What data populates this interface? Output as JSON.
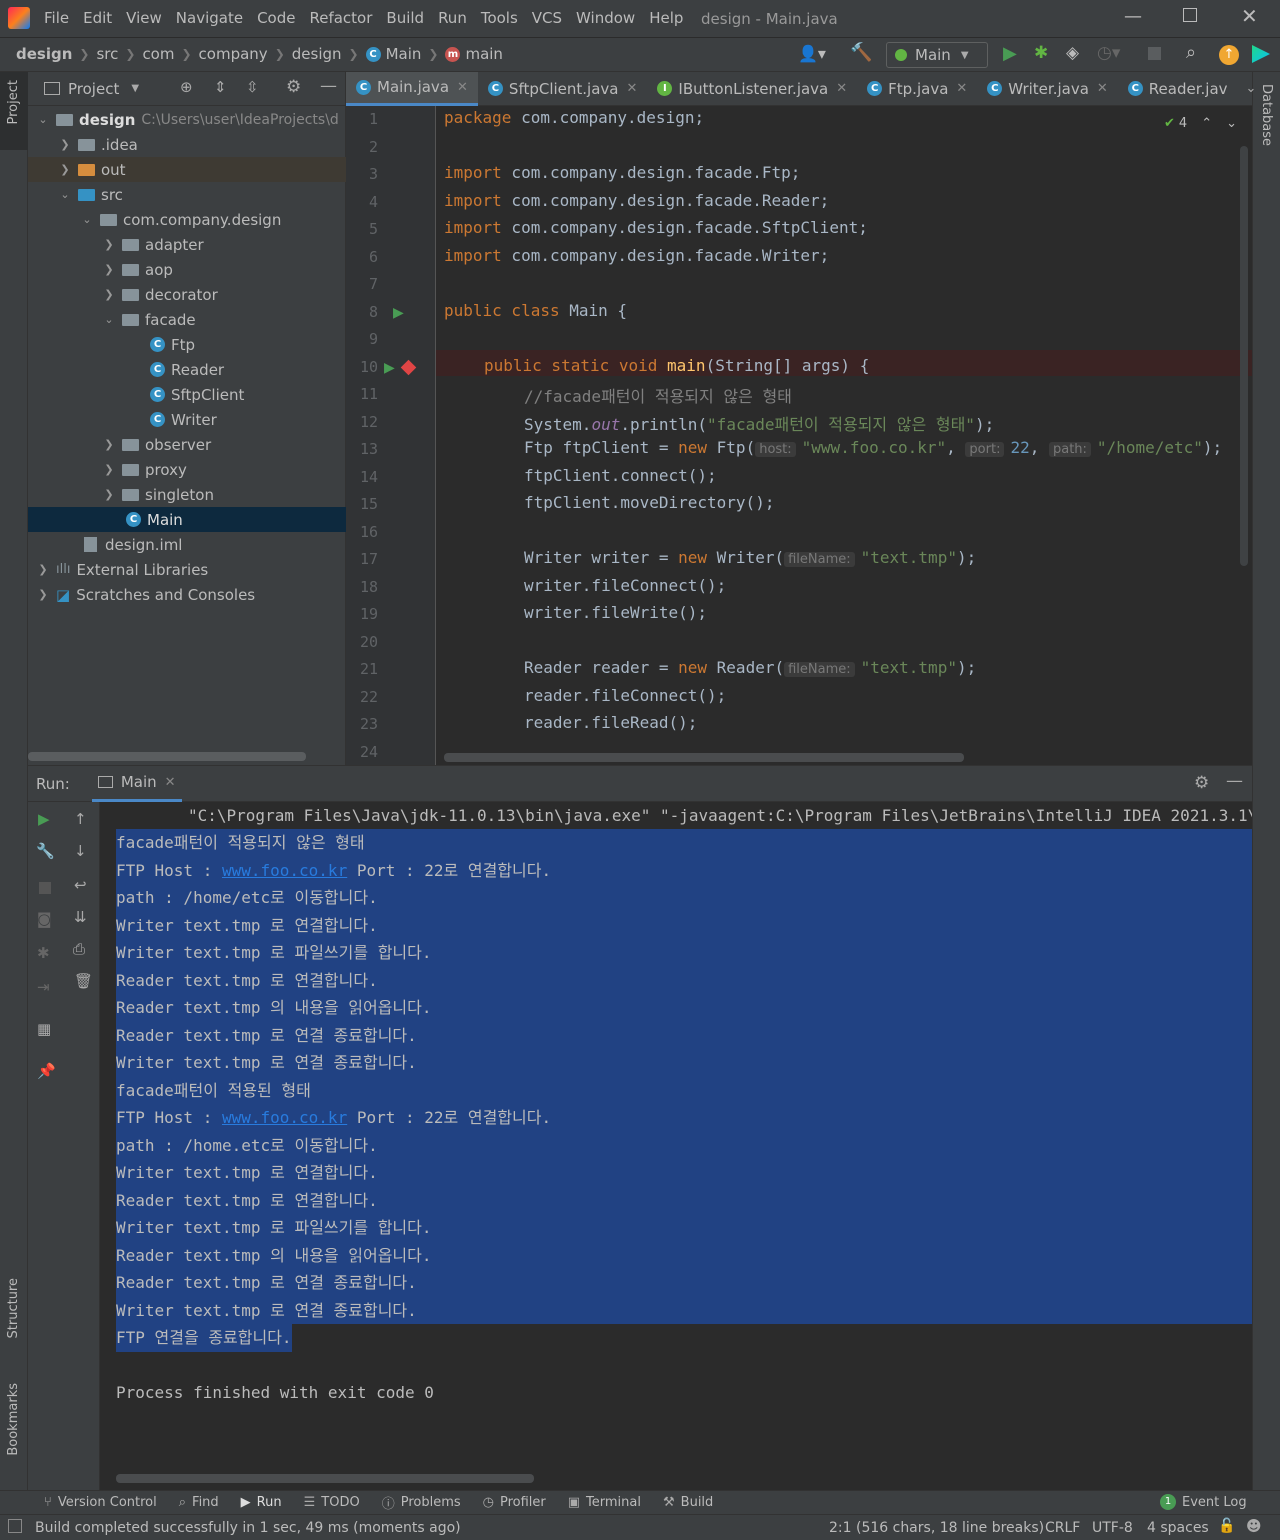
{
  "app": {
    "window_title": "design - Main.java",
    "menu": [
      "File",
      "Edit",
      "View",
      "Navigate",
      "Code",
      "Refactor",
      "Build",
      "Run",
      "Tools",
      "VCS",
      "Window",
      "Help"
    ]
  },
  "breadcrumb": [
    "design",
    "src",
    "com",
    "company",
    "design",
    "Main",
    "main"
  ],
  "toolbar": {
    "run_config": "Main"
  },
  "left_stripe": {
    "project": "Project",
    "structure": "Structure",
    "bookmarks": "Bookmarks"
  },
  "right_stripe": {
    "database": "Database"
  },
  "project": {
    "title": "Project",
    "root_name": "design",
    "root_path": "C:\\Users\\user\\IdeaProjects\\d",
    "items": [
      ".idea",
      "out",
      "src",
      "com.company.design",
      "adapter",
      "aop",
      "decorator",
      "facade",
      "Ftp",
      "Reader",
      "SftpClient",
      "Writer",
      "observer",
      "proxy",
      "singleton",
      "Main",
      "design.iml",
      "External Libraries",
      "Scratches and Consoles"
    ]
  },
  "tabs": [
    "Main.java",
    "SftpClient.java",
    "IButtonListener.java",
    "Ftp.java",
    "Writer.java",
    "Reader.jav"
  ],
  "editor": {
    "inspections": "4",
    "lines": [
      "1",
      "2",
      "3",
      "4",
      "5",
      "6",
      "7",
      "8",
      "9",
      "10",
      "11",
      "12",
      "13",
      "14",
      "15",
      "16",
      "17",
      "18",
      "19",
      "20",
      "21",
      "22",
      "23",
      "24"
    ],
    "package_kw": "package",
    "package_name": " com.company.design;",
    "import_kw": "import",
    "imports": [
      " com.company.design.facade.Ftp;",
      " com.company.design.facade.Reader;",
      " com.company.design.facade.SftpClient;",
      " com.company.design.facade.Writer;"
    ],
    "class_kw": "public class",
    "class_rest": " Main {",
    "main_kw": "public static void",
    "main_name": "main",
    "main_rest": "(String[] args) {",
    "comment": "//facade패턴이 적용되지 않은 형태",
    "println_a": "System.",
    "println_out": "out",
    "println_b": ".println(",
    "println_str": "\"facade패턴이 적용되지 않은 형태\"",
    "println_c": ");",
    "ftp_a": "Ftp ftpClient = ",
    "new": "new",
    "ftp_b": " Ftp(",
    "hint_host": "host:",
    "ftp_host": "\"www.foo.co.kr\"",
    "hint_port": "port:",
    "ftp_port": "22",
    "hint_path": "path:",
    "ftp_path": "\"/home/etc\"",
    "ftp_end": ");",
    "connect": "ftpClient.connect();",
    "move": "ftpClient.moveDirectory();",
    "writer_a": "Writer writer = ",
    "writer_b": " Writer(",
    "hint_file": "fileName:",
    "tmp": "\"text.tmp\"",
    "end": ");",
    "wconnect": "writer.fileConnect();",
    "wwrite": "writer.fileWrite();",
    "reader_a": "Reader reader = ",
    "reader_b": " Reader(",
    "rconnect": "reader.fileConnect();",
    "rread": "reader.fileRead();",
    "comma": ", "
  },
  "run": {
    "label": "Run:",
    "tab": "Main",
    "command": "\"C:\\Program Files\\Java\\jdk-11.0.13\\bin\\java.exe\" \"-javaagent:C:\\Program Files\\JetBrains\\IntelliJ IDEA 2021.3.1\\lib",
    "host_prefix": "FTP Host : ",
    "host_link": "www.foo.co.kr",
    "host_suffix": " Port : 22로 연결합니다.",
    "out": [
      "facade패턴이 적용되지 않은 형태",
      "path : /home/etc로 이동합니다.",
      "Writer text.tmp 로 연결합니다.",
      "Writer text.tmp 로 파일쓰기를 합니다.",
      "Reader text.tmp 로 연결합니다.",
      "Reader text.tmp 의 내용을 읽어옵니다.",
      "Reader text.tmp 로 연결 종료합니다.",
      "Writer text.tmp 로 연결 종료합니다.",
      "facade패턴이 적용된 형태",
      "path : /home.etc로 이동합니다.",
      "Writer text.tmp 로 연결합니다.",
      "Reader text.tmp 로 연결합니다.",
      "Writer text.tmp 로 파일쓰기를 합니다.",
      "Reader text.tmp 의 내용을 읽어옵니다.",
      "Reader text.tmp 로 연결 종료합니다.",
      "Writer text.tmp 로 연결 종료합니다.",
      "FTP 연결을 종료합니다.",
      "Process finished with exit code 0"
    ]
  },
  "bottom_tools": [
    "Version Control",
    "Find",
    "Run",
    "TODO",
    "Problems",
    "Profiler",
    "Terminal",
    "Build"
  ],
  "event_log": {
    "count": "1",
    "label": "Event Log"
  },
  "status": {
    "message": "Build completed successfully in 1 sec, 49 ms (moments ago)",
    "position": "2:1 (516 chars, 18 line breaks)",
    "line_sep": "CRLF",
    "encoding": "UTF-8",
    "indent": "4 spaces"
  },
  "colors": {
    "accent": "#4a88c7",
    "selection": "#214283",
    "keyword": "#cc7832",
    "string": "#6a8759",
    "run_green": "#499c54"
  }
}
